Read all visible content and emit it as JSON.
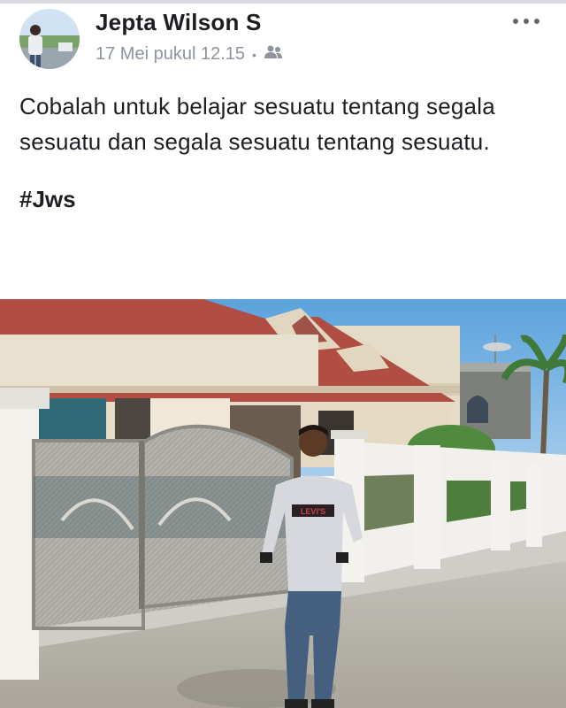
{
  "post": {
    "author": "Jepta Wilson S",
    "timestamp": "17 Mei pukul 12.15",
    "separator": "•",
    "audience_icon": "friends-icon",
    "more_icon": "more-options-icon",
    "text": "Cobalah untuk belajar sesuatu  tentang segala sesuatu dan segala sesuatu tentang sesuatu.",
    "hashtag": "#Jws"
  },
  "photo": {
    "shirt_text": "LEVI'S"
  }
}
